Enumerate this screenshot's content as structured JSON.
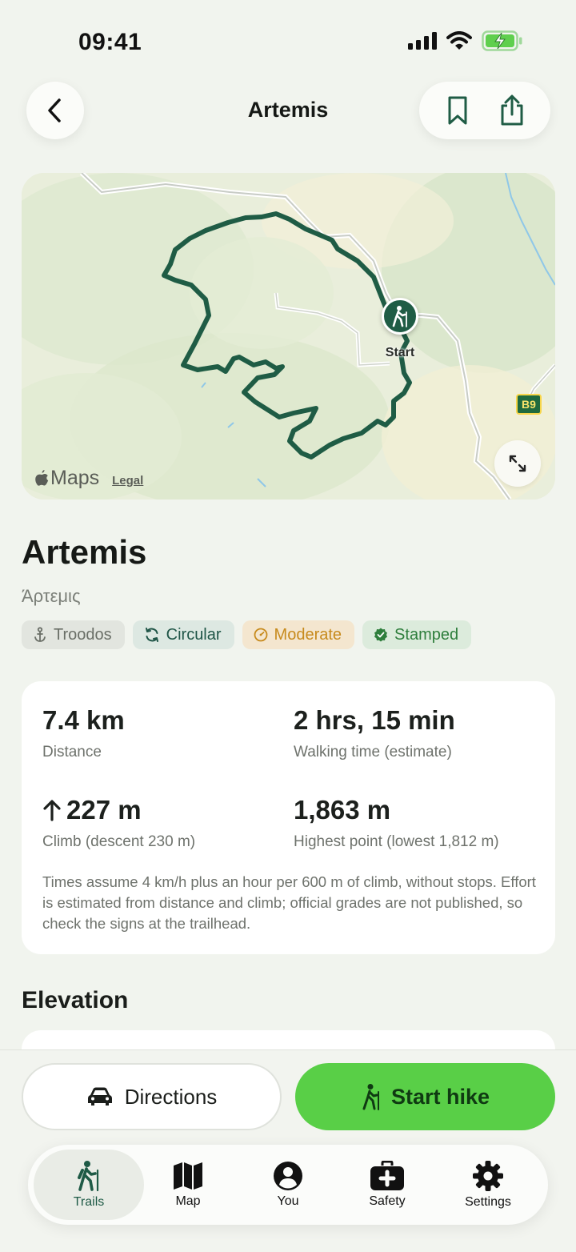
{
  "status_bar": {
    "time": "09:41"
  },
  "nav": {
    "title": "Artemis"
  },
  "map": {
    "start_label": "Start",
    "maps_attribution": "Maps",
    "legal_label": "Legal",
    "road_badge": "B9",
    "road_side_text": "B9"
  },
  "trail": {
    "name": "Artemis",
    "local_name": "Άρτεμις",
    "tags": [
      {
        "label": "Troodos",
        "icon": "anchor-icon"
      },
      {
        "label": "Circular",
        "icon": "loop-icon"
      },
      {
        "label": "Moderate",
        "icon": "gauge-icon"
      },
      {
        "label": "Stamped",
        "icon": "check-badge-icon"
      }
    ]
  },
  "stats": {
    "distance": {
      "value": "7.4 km",
      "label": "Distance"
    },
    "walking_time": {
      "value": "2 hrs, 15 min",
      "label": "Walking time (estimate)"
    },
    "climb": {
      "value": "227 m",
      "label": "Climb (descent 230 m)"
    },
    "highest": {
      "value": "1,863 m",
      "label": "Highest point (lowest 1,812 m)"
    },
    "note": "Times assume 4 km/h plus an hour per 600 m of climb, without stops. Effort is estimated from distance and climb; official grades are not published, so check the signs at the trailhead."
  },
  "sections": {
    "elevation": "Elevation"
  },
  "actions": {
    "directions": "Directions",
    "start_hike": "Start hike"
  },
  "tabs": [
    {
      "label": "Trails",
      "icon": "hiker-icon",
      "active": true
    },
    {
      "label": "Map",
      "icon": "map-icon",
      "active": false
    },
    {
      "label": "You",
      "icon": "person-icon",
      "active": false
    },
    {
      "label": "Safety",
      "icon": "first-aid-icon",
      "active": false
    },
    {
      "label": "Settings",
      "icon": "gear-icon",
      "active": false
    }
  ],
  "colors": {
    "accent_green": "#59cf47",
    "trail_green": "#1f5c45",
    "moderate": "#c78a1c",
    "stamped": "#2e7e3c"
  }
}
